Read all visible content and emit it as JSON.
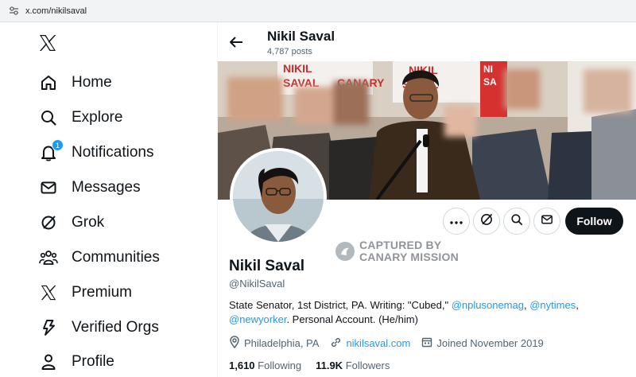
{
  "browser": {
    "url": "x.com/nikilsaval"
  },
  "nav": {
    "items": [
      {
        "label": "Home",
        "icon": "home-icon"
      },
      {
        "label": "Explore",
        "icon": "search-icon"
      },
      {
        "label": "Notifications",
        "icon": "bell-icon",
        "badge": "1"
      },
      {
        "label": "Messages",
        "icon": "envelope-icon"
      },
      {
        "label": "Grok",
        "icon": "grok-icon"
      },
      {
        "label": "Communities",
        "icon": "people-icon"
      },
      {
        "label": "Premium",
        "icon": "x-logo-icon"
      },
      {
        "label": "Verified Orgs",
        "icon": "lightning-icon"
      },
      {
        "label": "Profile",
        "icon": "person-icon"
      }
    ]
  },
  "header": {
    "name": "Nikil Saval",
    "posts": "4,787 posts"
  },
  "profile": {
    "name": "Nikil Saval",
    "handle": "@NikilSaval",
    "bio_prefix": "State Senator, 1st District, PA. Writing: \"Cubed,\" ",
    "bio_link1": "@nplusonemag",
    "bio_sep": ", ",
    "bio_link2": "@nytimes",
    "bio_sep2": ",",
    "bio_link3": "@newyorker",
    "bio_suffix": ". Personal Account. (He/him)",
    "location": "Philadelphia, PA",
    "website": "nikilsaval.com",
    "joined": "Joined November 2019",
    "following_count": "1,610",
    "following_label": "Following",
    "followers_count": "11.9K",
    "followers_label": "Followers",
    "follow_button": "Follow"
  },
  "banner": {
    "sign_text": "NIKIL SAVAL"
  },
  "watermark": {
    "line1": "CAPTURED BY",
    "line2": "CANARY MISSION"
  },
  "colors": {
    "accent": "#1d9bf0",
    "text": "#0f1419",
    "muted": "#536471",
    "follow_bg": "#0f1419"
  }
}
